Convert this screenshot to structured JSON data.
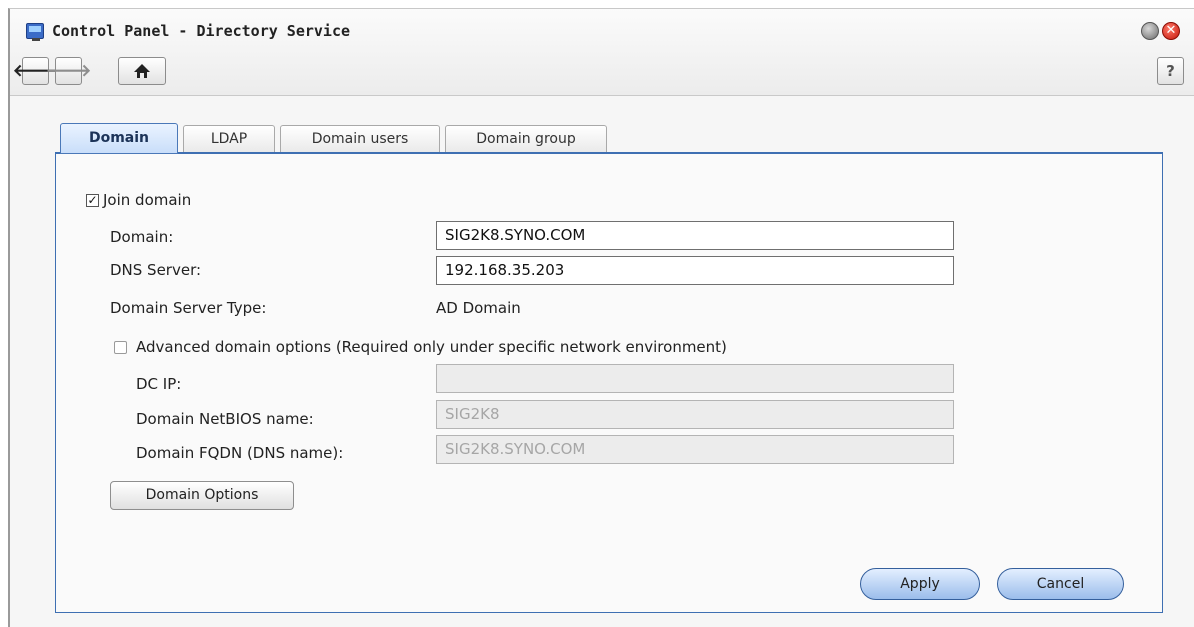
{
  "window": {
    "title": "Control Panel - Directory Service",
    "close_glyph": "✕"
  },
  "toolbar": {
    "back_glyph": "🡐",
    "forward_glyph": "🡒",
    "help_glyph": "?"
  },
  "tabs": [
    {
      "label": "Domain",
      "active": true
    },
    {
      "label": "LDAP",
      "active": false
    },
    {
      "label": "Domain users",
      "active": false
    },
    {
      "label": "Domain group",
      "active": false
    }
  ],
  "form": {
    "join_domain": {
      "label": "Join domain",
      "checked": true
    },
    "domain": {
      "label": "Domain:",
      "value": "SIG2K8.SYNO.COM"
    },
    "dns_server": {
      "label": "DNS Server:",
      "value": "192.168.35.203"
    },
    "server_type": {
      "label": "Domain Server Type:",
      "value": "AD Domain"
    },
    "advanced": {
      "label": "Advanced domain options (Required only under specific network environment)",
      "checked": false
    },
    "dc_ip": {
      "label": "DC IP:",
      "value": ""
    },
    "netbios": {
      "label": "Domain NetBIOS name:",
      "value": "SIG2K8"
    },
    "fqdn": {
      "label": "Domain FQDN (DNS name):",
      "value": "SIG2K8.SYNO.COM"
    },
    "domain_options_button": "Domain Options"
  },
  "actions": {
    "apply": "Apply",
    "cancel": "Cancel"
  },
  "colors": {
    "accent": "#3e6fb2",
    "active_tab": "#c9defa"
  },
  "icons": {
    "app": "control-panel-icon",
    "minimize": "minimize-icon",
    "close": "close-icon",
    "back": "arrow-left-icon",
    "forward": "arrow-right-icon",
    "home": "home-icon",
    "help": "help-icon",
    "checked": "checkbox-checked-icon"
  }
}
